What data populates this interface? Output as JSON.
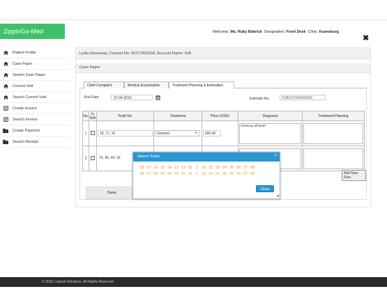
{
  "header": {
    "app_title": "ZippinGo-Med",
    "welcome_prefix": "Welcome,",
    "user_name": "Ms. Ruby Bobrick",
    "designation_label": "Designation:",
    "designation": "Front Desk",
    "clinic_label": "Clinic:",
    "clinic": "Keansburg",
    "close_glyph": "✖"
  },
  "sidebar": {
    "items": [
      {
        "label": "Patient Profile",
        "icon": "home-icon"
      },
      {
        "label": "Case Paper",
        "icon": "home-icon"
      },
      {
        "label": "Search Case Paper",
        "icon": "home-icon"
      },
      {
        "label": "Current Visit",
        "icon": "home-icon"
      },
      {
        "label": "Search Current Visit",
        "icon": "home-icon"
      },
      {
        "label": "Create Invoice",
        "icon": "document-icon"
      },
      {
        "label": "Search Invoice",
        "icon": "document-icon"
      },
      {
        "label": "Create Payment",
        "icon": "folder-icon"
      },
      {
        "label": "Search Receipt",
        "icon": "folder-icon"
      }
    ]
  },
  "main": {
    "patient_info": "Lydia Greenway, Contact No: 90717442266, Account Name: N/A",
    "section_title": "Case Paper",
    "tabs": [
      "Chief Complaint",
      "Medical Examination",
      "Treatment Planning & Estimation"
    ],
    "visit_date_label": "Visit Date:",
    "visit_date": "21-04-2016",
    "estimate_label": "Estimate No:",
    "estimate_no": "KNEST/160400002",
    "columns": [
      "No.",
      "Is N/A",
      "Tooth No.",
      "Treatment",
      "Price (USD)",
      "Diagnosis",
      "Treatment Planning"
    ],
    "rows": [
      {
        "no": "1",
        "tooth": "18, 17, 16",
        "treatment": "General",
        "price": "500.00",
        "diagnosis": "cleaning all teeth",
        "planning": ""
      },
      {
        "no": "2",
        "tooth": "15, 45, 44, 33",
        "treatment": "",
        "price": "",
        "diagnosis": "",
        "planning": ""
      }
    ],
    "add_row_label": "Add New Row",
    "save_label": "Save"
  },
  "modal": {
    "title": "Select Tooth",
    "close_glyph": "×",
    "upper_teeth": [
      "18",
      "17",
      "16",
      "15",
      "14",
      "13",
      "12",
      "11",
      "/",
      "21",
      "22",
      "23",
      "24",
      "25",
      "26",
      "27",
      "28"
    ],
    "lower_teeth": [
      "48",
      "47",
      "46",
      "45",
      "44",
      "43",
      "42",
      "41",
      "/",
      "31",
      "32",
      "33",
      "34",
      "35",
      "36",
      "37",
      "38"
    ],
    "close_label": "Close"
  },
  "footer": {
    "copyright": "© 2016 Logiciel Solutions. All Rights Reserved"
  },
  "colors": {
    "brand_green": "#3fc06a",
    "modal_blue": "#2c95d1",
    "tooth_orange": "#e08a2a",
    "footer_dark": "#2a2a2a"
  }
}
